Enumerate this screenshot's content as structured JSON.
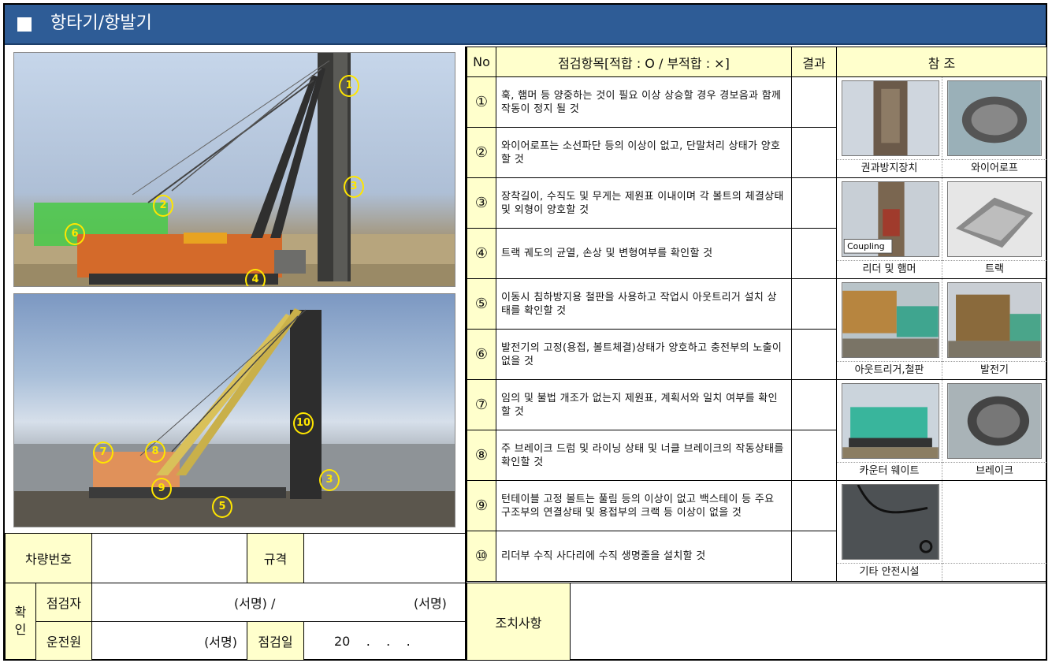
{
  "header": {
    "title": "항타기/항발기"
  },
  "photo_markers": {
    "top": [
      "1",
      "2",
      "3",
      "4",
      "6"
    ],
    "bottom": [
      "7",
      "8",
      "9",
      "10",
      "3",
      "5"
    ]
  },
  "table": {
    "headers": {
      "no": "No",
      "item": "점검항목[적합 : O / 부적합 : ×]",
      "result": "결과",
      "ref": "참 조"
    },
    "rows": [
      {
        "no": "①",
        "text": "훅, 햄머 등 양중하는 것이 필요 이상 상승할 경우 경보음과 함께 작동이 정지 될 것"
      },
      {
        "no": "②",
        "text": "와이어로프는 소선파단 등의 이상이 없고, 단말처리 상태가 양호할 것"
      },
      {
        "no": "③",
        "text": "장착길이, 수직도 및 무게는 제원표 이내이며 각 볼트의 체결상태 및 외형이 양호할 것"
      },
      {
        "no": "④",
        "text": "트랙 궤도의 균열, 손상 및 변형여부를 확인할 것"
      },
      {
        "no": "⑤",
        "text": "이동시 침하방지용 철판을 사용하고 작업시 아웃트리거 설치 상태를 확인할 것"
      },
      {
        "no": "⑥",
        "text": "발전기의 고정(용접, 볼트체결)상태가 양호하고 충전부의 노출이 없을 것"
      },
      {
        "no": "⑦",
        "text": "임의 및 불법 개조가 없는지 제원표, 계획서와 일치 여부를 확인할 것"
      },
      {
        "no": "⑧",
        "text": "주 브레이크 드럼 및 라이닝 상태 및 너클 브레이크의 작동상태를 확인할 것"
      },
      {
        "no": "⑨",
        "text": "턴테이블 고정 볼트는 풀림 등의 이상이 없고 백스테이 등 주요 구조부의 연결상태 및 용접부의 크랙 등 이상이 없을 것"
      },
      {
        "no": "⑩",
        "text": "리더부 수직 사다리에 수직 생명줄을 설치할 것"
      }
    ],
    "refs": [
      {
        "left": "권과방지장치",
        "right": "와이어로프",
        "left_label": ""
      },
      {
        "left": "리더 및 햄머",
        "right": "트랙",
        "left_label": "Coupling"
      },
      {
        "left": "아웃트리거,철판",
        "right": "발전기",
        "left_label": ""
      },
      {
        "left": "카운터 웨이트",
        "right": "브레이크",
        "left_label": ""
      },
      {
        "left": "기타 안전시설",
        "right": "",
        "left_label": ""
      }
    ]
  },
  "bottom": {
    "vehicle_no_label": "차량번호",
    "spec_label": "규격",
    "confirm_label": "확\n인",
    "inspector_label": "점검자",
    "inspector_sign": "(서명) /",
    "inspector_sign2": "(서명)",
    "driver_label": "운전원",
    "driver_sign": "(서명)",
    "inspect_date_label": "점검일",
    "inspect_date_value": "20    .    .    .",
    "action_label": "조치사항"
  }
}
